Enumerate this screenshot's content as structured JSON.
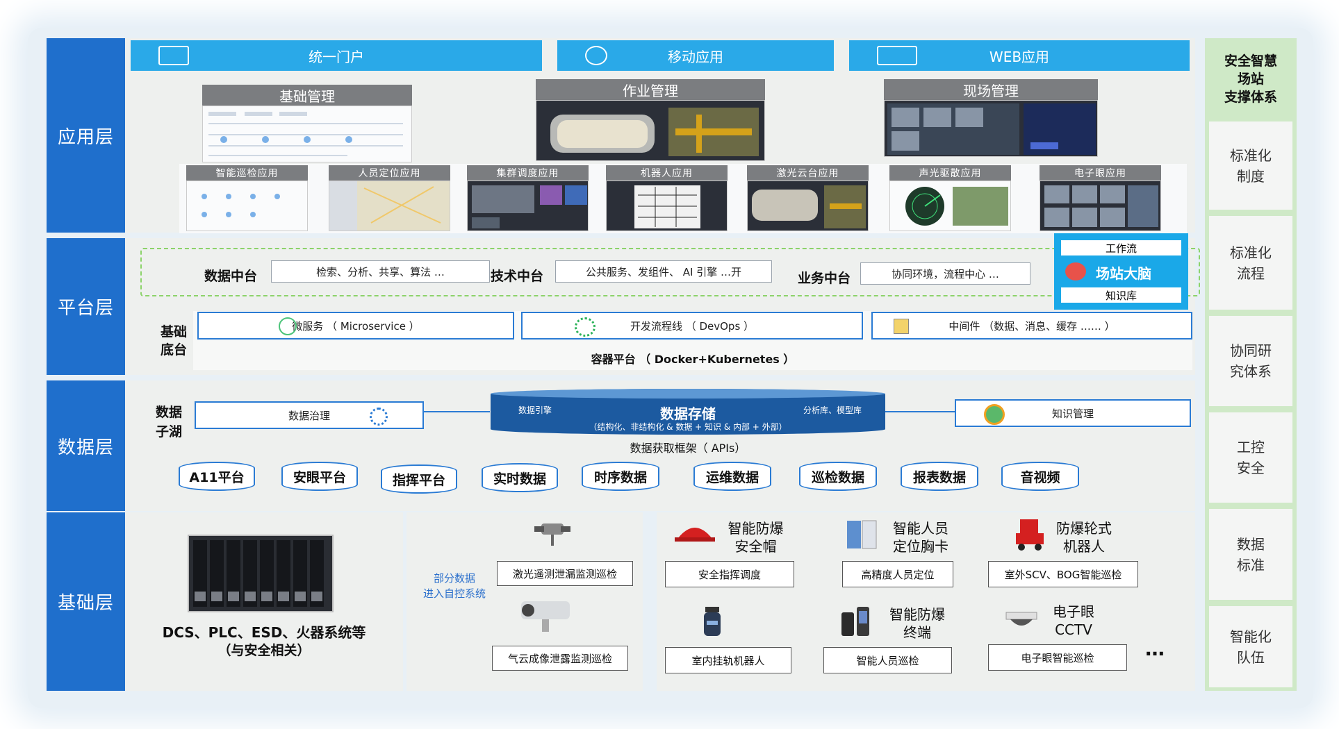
{
  "layers": {
    "app": "应用层",
    "platform": "平台层",
    "data": "数据层",
    "base": "基础层"
  },
  "tabs": [
    "统一门户",
    "移动应用",
    "WEB应用"
  ],
  "app": {
    "big_titles": [
      "基础管理",
      "作业管理",
      "现场管理"
    ],
    "small_titles": [
      "智能巡检应用",
      "人员定位应用",
      "集群调度应用",
      "机器人应用",
      "激光云台应用",
      "声光驱散应用",
      "电子眼应用"
    ]
  },
  "platform": {
    "data_mid": "数据中台",
    "data_mid_desc": "检索、分析、共享、算法 …",
    "tech_mid": "技术中台",
    "tech_mid_desc": "公共服务、发组件、 AI 引擎 …开",
    "biz_mid": "业务中台",
    "biz_mid_desc": "协同环境，流程中心 …",
    "brain_top": "工作流",
    "brain_title": "场站大脑",
    "brain_bottom": "知识库",
    "base_label": "基础\n底台",
    "micro": "微服务 （ Microservice ）",
    "devops": "开发流程线 （ DevOps ）",
    "middleware": "中间件 （数据、消息、缓存 …… ）",
    "container": "容器平台 （ Docker+Kubernetes ）"
  },
  "data": {
    "lake": "数据\n子湖",
    "governance": "数据治理",
    "storage_title": "数据存储",
    "storage_sub": "（结构化、非结构化 & 数据 + 知识 & 内部 + 外部）",
    "engine": "数据引擎",
    "analytics": "分析库、模型库",
    "knowledge": "知识管理",
    "api": "数据获取框架（ APIs）",
    "sources": [
      "A11平台",
      "安眼平台",
      "指挥平台",
      "实时数据",
      "时序数据",
      "运维数据",
      "巡检数据",
      "报表数据",
      "音视频"
    ]
  },
  "base": {
    "dcs": "DCS、PLC、ESD、火器系统等",
    "dcs_sub": "（与安全相关）",
    "partial": "部分数据\n进入自控系统",
    "laser": "激光遥测泄漏监测巡检",
    "gas": "气云成像泄露监测巡检",
    "devices": [
      {
        "name": "智能防爆\n安全帽",
        "box": "安全指挥调度"
      },
      {
        "name": "智能人员\n定位胸卡",
        "box": "高精度人员定位"
      },
      {
        "name": "防爆轮式\n机器人",
        "box": "室外SCV、BOG智能巡检"
      },
      {
        "name": "",
        "box": "室内挂轨机器人"
      },
      {
        "name": "智能防爆\n终端",
        "box": "智能人员巡检"
      },
      {
        "name": "电子眼\nCCTV",
        "box": "电子眼智能巡检"
      }
    ],
    "more": "…"
  },
  "side": {
    "title": "安全智慧\n场站\n支撑体系",
    "items": [
      "标准化\n制度",
      "标准化\n流程",
      "协同研\n究体系",
      "工控\n安全",
      "数据\n标准",
      "智能化\n队伍"
    ]
  },
  "colors": {
    "layer": "#1f6fcc",
    "tab": "#2aa9e8",
    "dash": "#8cd36a",
    "brain": "#1aa8e8"
  }
}
